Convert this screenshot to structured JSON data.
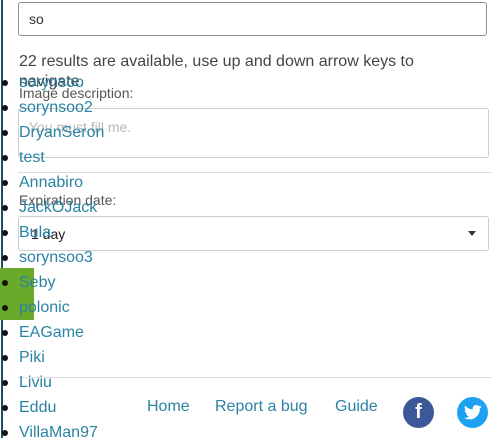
{
  "search": {
    "value": "so"
  },
  "status_text": "22 results are available, use up and down arrow keys to navigate.",
  "image_description": {
    "label": "Image description:",
    "placeholder": "You must fill me."
  },
  "expiration": {
    "label": "Expiration date:",
    "selected": "1 day"
  },
  "suggestions": [
    "sorynsoo",
    "sorynsoo2",
    "DryanSeron",
    "test",
    "Annabiro",
    "JackOJack",
    "Bula",
    "sorynsoo3",
    "Seby",
    "polonic",
    "EAGame",
    "Piki",
    "Liviu",
    "Eddu",
    "VillaMan97"
  ],
  "footer": {
    "home": "Home",
    "report": "Report a bug",
    "guide": "Guide",
    "facebook_glyph": "f"
  },
  "colors": {
    "link": "#2a82a4",
    "facebook": "#3b5998",
    "twitter": "#1da1f2",
    "highlight": "#6aaa2a"
  },
  "icons": {
    "facebook": "facebook-icon",
    "twitter": "twitter-icon",
    "select_caret": "caret-down-icon"
  }
}
